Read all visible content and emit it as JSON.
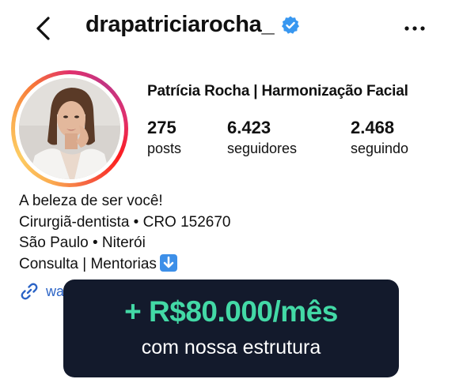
{
  "header": {
    "username": "drapatriciarocha_",
    "back_icon": "chevron-left-icon",
    "verified_icon": "verified-badge-icon",
    "more_icon": "more-horizontal-icon"
  },
  "profile": {
    "full_name": "Patrícia Rocha | Harmonização Facial",
    "stats": [
      {
        "value": "275",
        "label": "posts"
      },
      {
        "value": "6.423",
        "label": "seguidores"
      },
      {
        "value": "2.468",
        "label": "seguindo"
      }
    ],
    "bio_lines": [
      "A beleza de ser você!",
      "Cirurgiã-dentista • CRO 152670",
      "São Paulo • Niterói",
      "Consulta | Mentorias"
    ],
    "bio_emoji_icon": "down-arrow-emoji-icon",
    "link_text": "wa",
    "link_icon": "link-icon"
  },
  "overlay": {
    "title": "+ R$80.000/mês",
    "subtitle": "com nossa estrutura"
  },
  "colors": {
    "overlay_bg": "#131a2c",
    "overlay_accent": "#43d9a6",
    "verified_blue": "#3897f0",
    "link_blue": "#2c64c6"
  }
}
